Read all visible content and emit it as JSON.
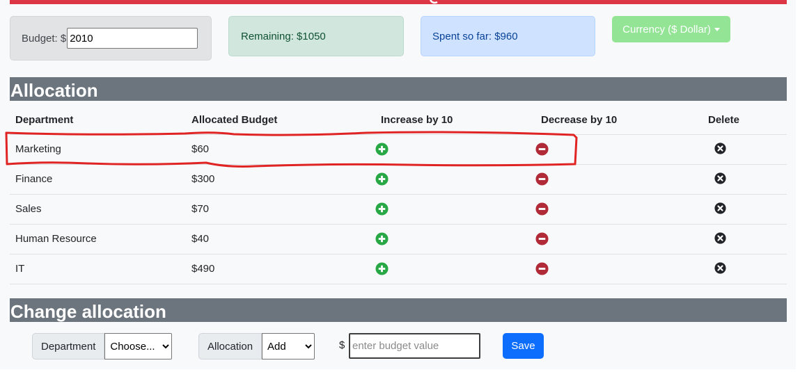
{
  "summary": {
    "budget_label": "Budget: $",
    "budget_value": "2010",
    "remaining_text": "Remaining: $1050",
    "spent_text": "Spent so far: $960"
  },
  "currency": {
    "label": "Currency ($ Dollar)",
    "icon": "caret-down-icon"
  },
  "allocation": {
    "title": "Allocation",
    "columns": [
      "Department",
      "Allocated Budget",
      "Increase by 10",
      "Decrease by 10",
      "Delete"
    ],
    "rows": [
      {
        "department": "Marketing",
        "budget": "$60"
      },
      {
        "department": "Finance",
        "budget": "$300"
      },
      {
        "department": "Sales",
        "budget": "$70"
      },
      {
        "department": "Human Resource",
        "budget": "$40"
      },
      {
        "department": "IT",
        "budget": "$490"
      }
    ],
    "icons": {
      "increase": "plus-circle-icon",
      "decrease": "minus-circle-icon",
      "delete": "x-circle-icon"
    },
    "highlighted_row": "Marketing"
  },
  "change": {
    "title": "Change allocation",
    "department_label": "Department",
    "department_selected": "Choose...",
    "allocation_label": "Allocation",
    "allocation_selected": "Add",
    "currency_symbol": "$",
    "amount_placeholder": "enter budget value",
    "save_label": "Save"
  },
  "colors": {
    "header_red": "#dc3545",
    "section_gray": "#6c757d",
    "increase_green": "#28a745",
    "decrease_red": "#b02a37",
    "delete_black": "#212529",
    "currency_button": "#93e495",
    "save_blue": "#0d6efd",
    "highlight_annotation": "#e02424"
  }
}
